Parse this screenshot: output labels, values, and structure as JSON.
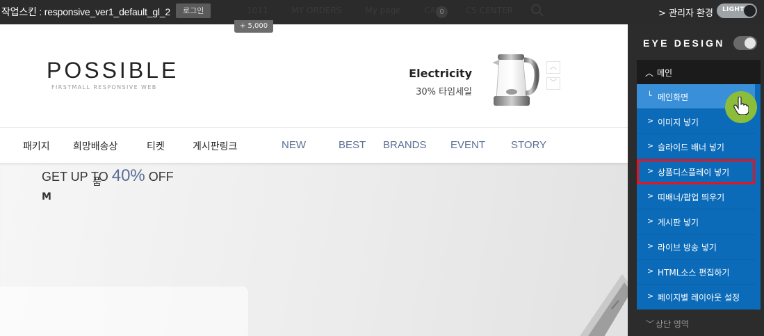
{
  "topbar": {
    "skin_label": "작업스킨 : responsive_ver1_default_gl_2",
    "login_button": "로그인",
    "ghost_nav": [
      "1011",
      "MY ORDERS",
      "My page",
      "CART"
    ],
    "cart_count": "0",
    "ghost_register": "CS CENTER",
    "admin_link": "> 관리자 환경",
    "theme_toggle_label": "LIGHT"
  },
  "price_tag": "+ 5,000",
  "header": {
    "logo": "POSSIBLE",
    "logo_sub": "FIRSTMALL RESPONSIVE WEB",
    "promo_title": "Electricity",
    "promo_sub": "30% 타임세일",
    "arrow_up": "︿",
    "arrow_down": "﹀"
  },
  "nav": {
    "items": [
      "패키지",
      "희망배송상",
      "티켓",
      "게시판링크",
      "NEW",
      "BEST",
      "BRANDS",
      "EVENT",
      "STORY"
    ],
    "wrap_text": "품"
  },
  "hero": {
    "text_prefix": "GET UP TO ",
    "percent": "40%",
    "text_suffix": " OFF",
    "line2": "M"
  },
  "panel": {
    "title": "EYE DESIGN",
    "section_head": "메인",
    "items": [
      {
        "icon": "└",
        "label": "메인화면"
      },
      {
        "icon": ">",
        "label": "이미지 넣기"
      },
      {
        "icon": ">",
        "label": "슬라이드 배너 넣기"
      },
      {
        "icon": ">",
        "label": "상품디스플레이 넣기"
      },
      {
        "icon": ">",
        "label": "띠배너/팝업 띄우기"
      },
      {
        "icon": ">",
        "label": "게시판 넣기"
      },
      {
        "icon": ">",
        "label": "라이브 방송 넣기"
      },
      {
        "icon": ">",
        "label": "HTML소스 편집하기"
      },
      {
        "icon": ">",
        "label": "페이지별 레이아웃 설정"
      }
    ],
    "footer_section": "상단 영역"
  },
  "colors": {
    "topbar_bg": "#2b2b2b",
    "panel_bg": "#2c2c2c",
    "menu_blue": "#0b6bb8",
    "menu_active": "#3990d8",
    "selected_outline": "#e8131c",
    "nav_accent": "#5a6e94"
  }
}
